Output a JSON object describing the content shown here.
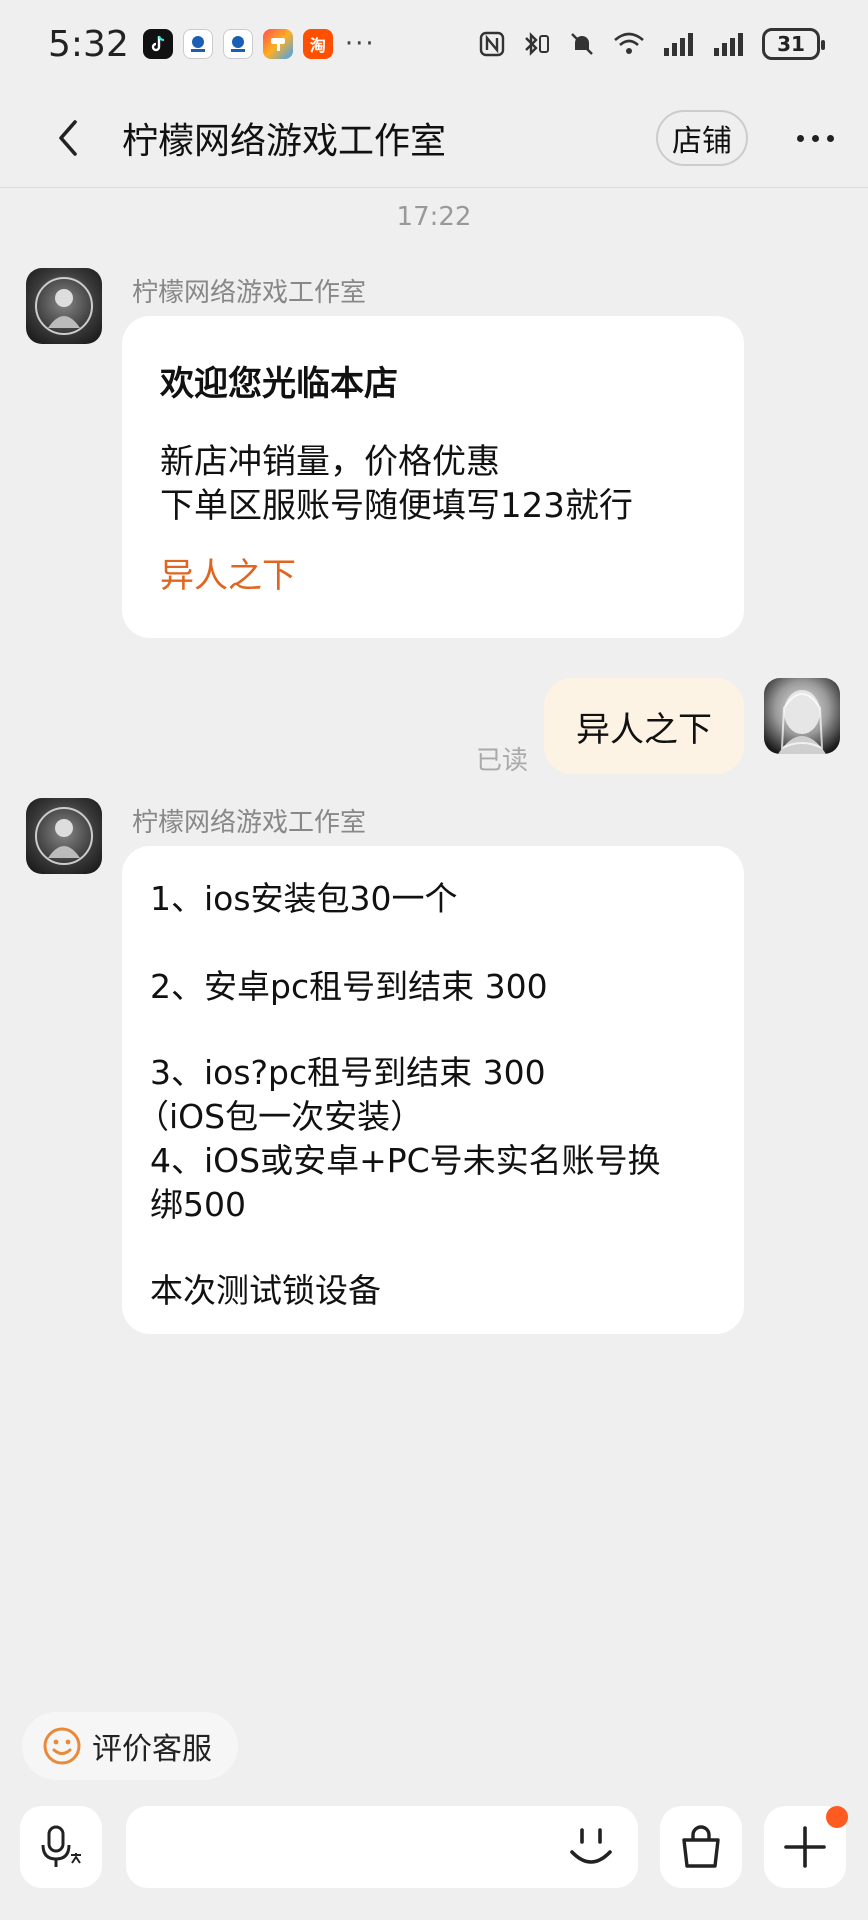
{
  "status_bar": {
    "time": "5:32",
    "dots": "···",
    "battery": "31",
    "app_icons": [
      "tiktok-icon",
      "bank-app-icon",
      "bank-app-icon-2",
      "paint-app-icon",
      "taobao-icon"
    ],
    "app_icon_text": {
      "taobao": "淘"
    }
  },
  "nav": {
    "title": "柠檬网络游戏工作室",
    "shop_label": "店铺"
  },
  "chat": {
    "timestamp": "17:22",
    "messages": [
      {
        "sender": "柠檬网络游戏工作室",
        "title": "欢迎您光临本店",
        "lines": [
          "新店冲销量，价格优惠",
          "下单区服账号随便填写123就行"
        ],
        "link": "异人之下"
      },
      {
        "sender": "me",
        "text": "异人之下",
        "status": "已读"
      },
      {
        "sender": "柠檬网络游戏工作室",
        "lines": [
          "1、ios安装包30一个",
          "2、安卓pc租号到结束  300",
          "3、ios?pc租号到结束 300",
          "（iOS包一次安装）",
          "4、iOS或安卓+PC号未实名账号换",
          "绑500",
          "本次测试锁设备"
        ]
      }
    ]
  },
  "rate_service": {
    "label": "评价客服"
  },
  "input": {
    "placeholder": ""
  },
  "colors": {
    "accent": "#e0651e",
    "user_bubble": "#fdf3e4",
    "notification_dot": "#ff5a1f"
  }
}
